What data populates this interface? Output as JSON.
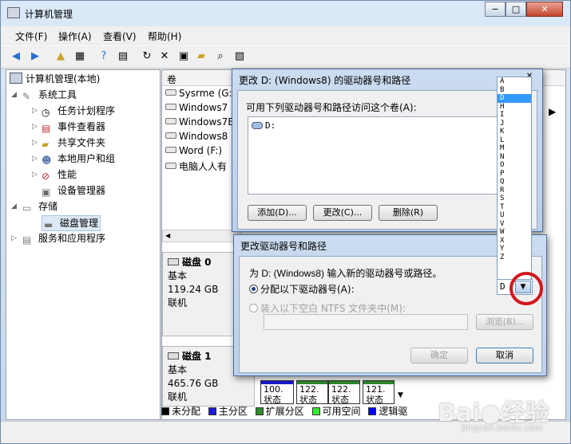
{
  "window": {
    "title": "计算机管理",
    "min": "−",
    "max": "□",
    "close": "✕"
  },
  "menu": [
    "文件(F)",
    "操作(A)",
    "查看(V)",
    "帮助(H)"
  ],
  "tree": {
    "root": "计算机管理(本地)",
    "system_tools": "系统工具",
    "task_scheduler": "任务计划程序",
    "event_viewer": "事件查看器",
    "shared_folders": "共享文件夹",
    "local_users": "本地用户和组",
    "performance": "性能",
    "device_manager": "设备管理器",
    "storage": "存储",
    "disk_management": "磁盘管理",
    "services": "服务和应用程序"
  },
  "volumes": {
    "header": "卷",
    "items": [
      "Sysrme (G:)",
      "Windows7 (",
      "Windows7E",
      "Windows8 (",
      "Word (F:)",
      "电脑人人有"
    ]
  },
  "disks": [
    {
      "name": "磁盘 0",
      "type": "基本",
      "size": "119.24 GB",
      "status": "联机"
    },
    {
      "name": "磁盘 1",
      "type": "基本",
      "size": "465.76 GB",
      "status": "联机"
    }
  ],
  "partitions": [
    {
      "size": "100.",
      "status": "状态"
    },
    {
      "size": "122.",
      "status": "状态"
    },
    {
      "size": "122.",
      "status": "状态"
    },
    {
      "size": "121.",
      "status": "状态"
    }
  ],
  "legend": [
    {
      "label": "未分配",
      "color": "#000000"
    },
    {
      "label": "主分区",
      "color": "#1b1bd8"
    },
    {
      "label": "扩展分区",
      "color": "#2e8b2e"
    },
    {
      "label": "可用空间",
      "color": "#33ee33"
    },
    {
      "label": "逻辑驱",
      "color": "#0000ff"
    }
  ],
  "dialog1": {
    "title": "更改 D: (Windows8) 的驱动器号和路径",
    "prompt": "可用下列驱动器号和路径访问这个卷(A):",
    "entry": "D:",
    "add": "添加(D)...",
    "change": "更改(C)...",
    "remove": "删除(R)",
    "close": "✕"
  },
  "dialog2": {
    "title": "更改驱动器号和路径",
    "prompt": "为 D: (Windows8) 输入新的驱动器号或路径。",
    "assign": "分配以下驱动器号(A):",
    "mount": "装入以下空白 NTFS 文件夹中(M):",
    "browse": "浏览(B)...",
    "ok": "确定",
    "cancel": "取消",
    "selected_letter": "D"
  },
  "drive_letters": [
    "A",
    "B",
    "D",
    "H",
    "I",
    "J",
    "K",
    "L",
    "M",
    "N",
    "O",
    "P",
    "Q",
    "R",
    "S",
    "T",
    "U",
    "V",
    "W",
    "X",
    "Y",
    "Z"
  ],
  "watermark": {
    "logo": "Bai 经验",
    "url": "jingyan.baidu.com"
  }
}
